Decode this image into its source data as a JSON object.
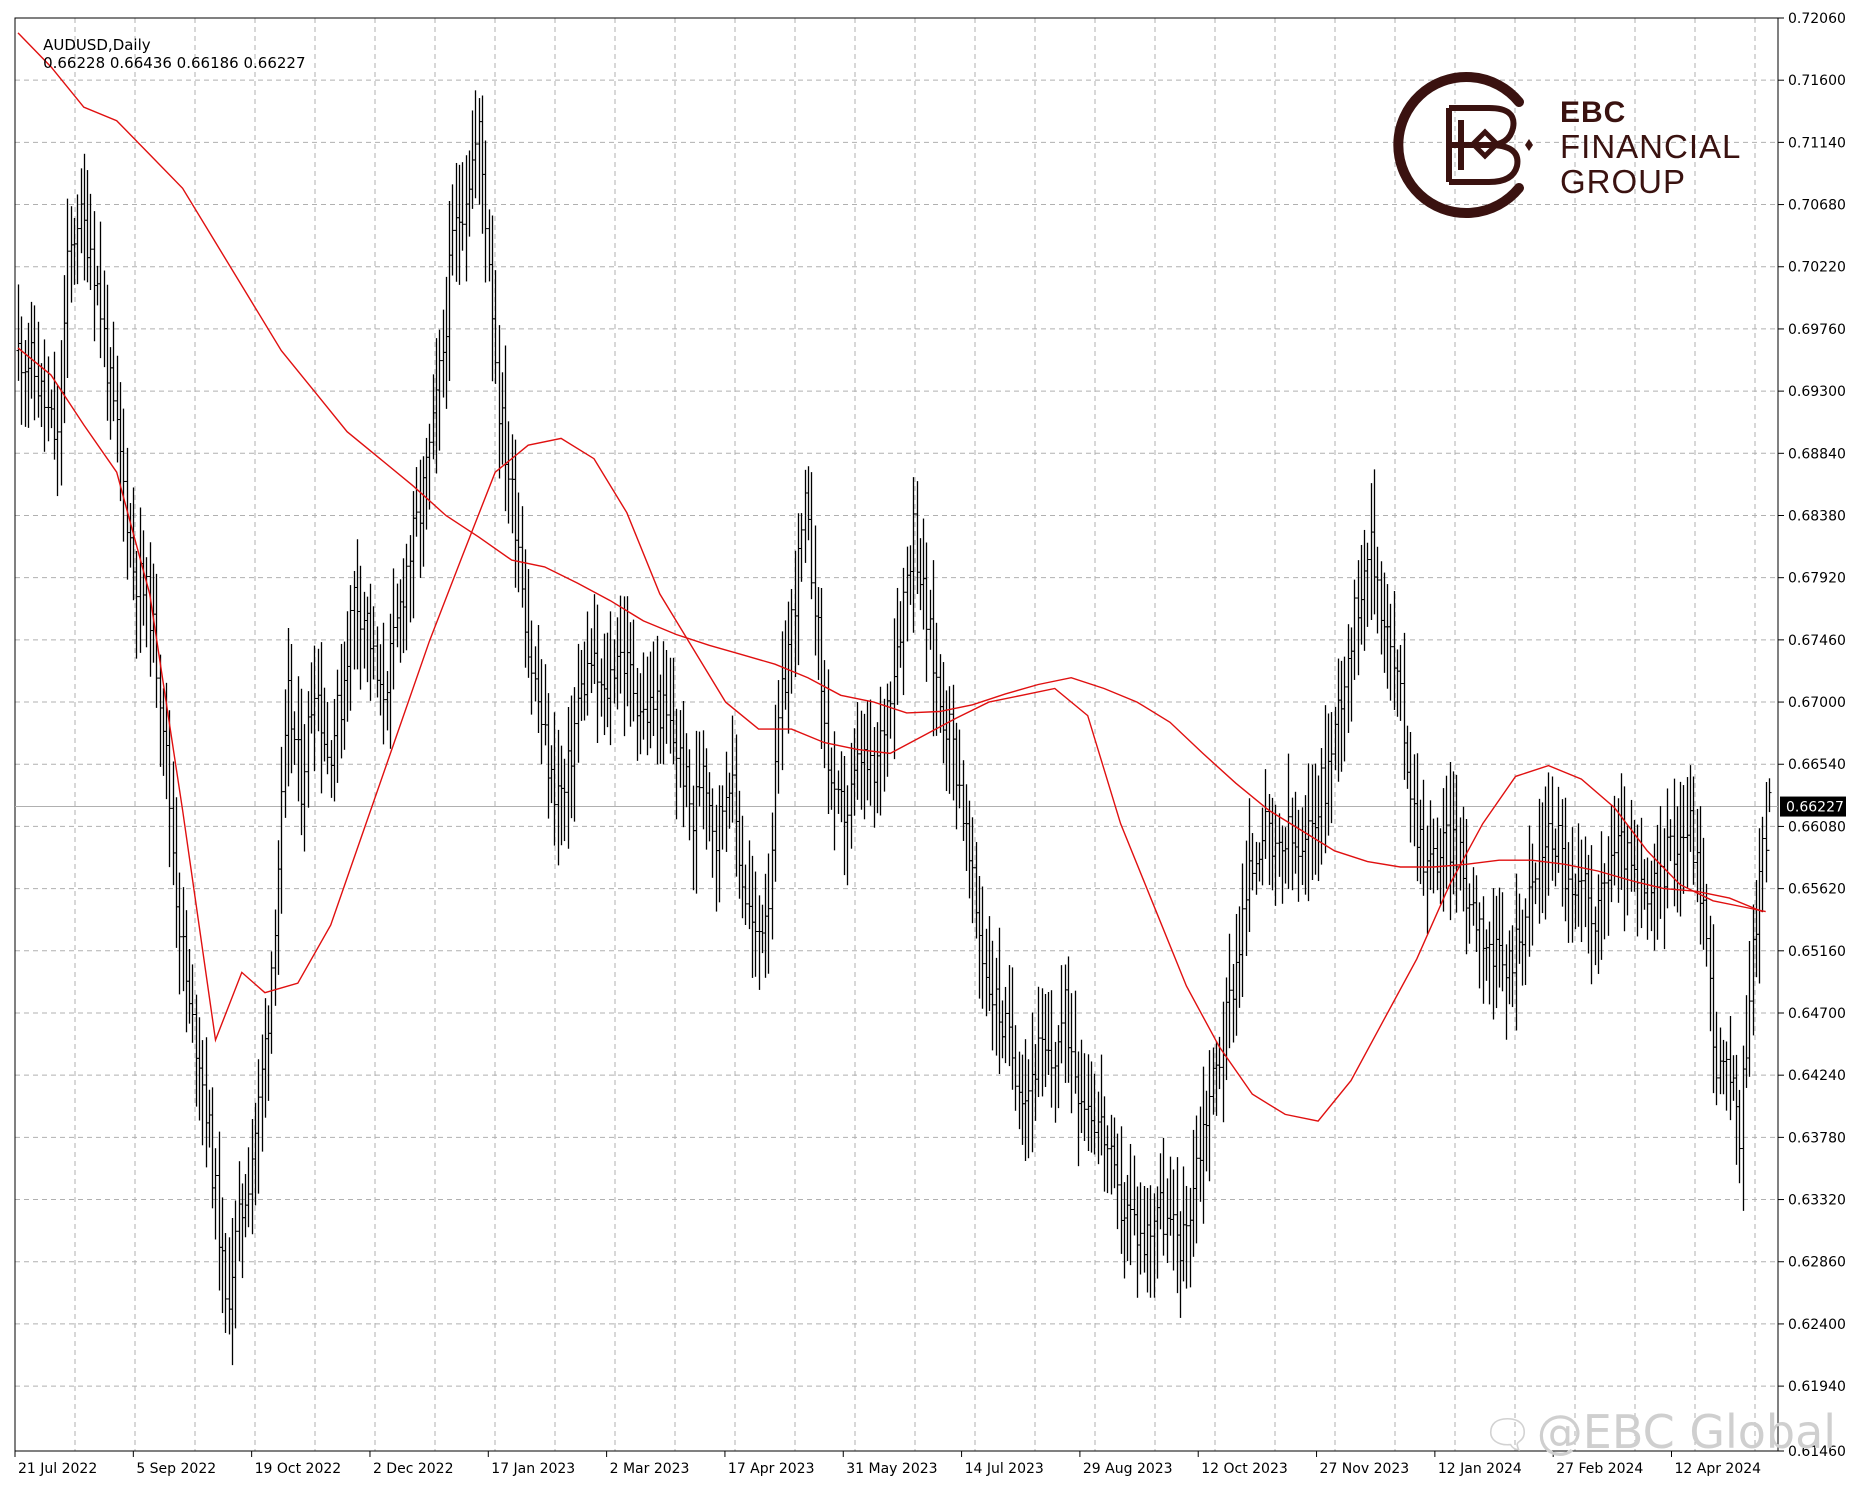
{
  "header": {
    "symbol": "AUDUSD,Daily",
    "ohlc": "0.66228 0.66436 0.66186 0.66227"
  },
  "logo": {
    "line1": "EBC",
    "line2": "FINANCIAL",
    "line3": "GROUP",
    "color": "#3a1210"
  },
  "watermark": {
    "text": "@EBC Global",
    "icon": "chat-bubble-icon"
  },
  "colors": {
    "bars": "#000000",
    "ma": "#e01010",
    "grid": "#b0b0b0",
    "price_tag_bg": "#000000",
    "price_tag_text": "#ffffff"
  },
  "chart_data": {
    "type": "ohlc_bar",
    "title": "AUDUSD,Daily",
    "symbol": "AUDUSD",
    "timeframe": "Daily",
    "last": {
      "open": 0.66228,
      "high": 0.66436,
      "low": 0.66186,
      "close": 0.66227
    },
    "current_price_label": "0.66227",
    "ylim": [
      0.6146,
      0.7206
    ],
    "grid": true,
    "y_ticks": [
      "0.72060",
      "0.71600",
      "0.71140",
      "0.70680",
      "0.70220",
      "0.69760",
      "0.69300",
      "0.68840",
      "0.68380",
      "0.67920",
      "0.67460",
      "0.67000",
      "0.66540",
      "0.66080",
      "0.65620",
      "0.65160",
      "0.64700",
      "0.64240",
      "0.63780",
      "0.63320",
      "0.62860",
      "0.62400",
      "0.61940",
      "0.61460"
    ],
    "x_ticks": [
      "21 Jul 2022",
      "5 Sep 2022",
      "19 Oct 2022",
      "2 Dec 2022",
      "17 Jan 2023",
      "2 Mar 2023",
      "17 Apr 2023",
      "31 May 2023",
      "14 Jul 2023",
      "29 Aug 2023",
      "12 Oct 2023",
      "27 Nov 2023",
      "12 Jan 2024",
      "27 Feb 2024",
      "12 Apr 2024"
    ],
    "close_path": [
      [
        0,
        0.696
      ],
      [
        8,
        0.695
      ],
      [
        16,
        0.692
      ],
      [
        24,
        0.689
      ],
      [
        30,
        0.702
      ],
      [
        36,
        0.706
      ],
      [
        44,
        0.704
      ],
      [
        50,
        0.699
      ],
      [
        56,
        0.693
      ],
      [
        62,
        0.688
      ],
      [
        70,
        0.68
      ],
      [
        80,
        0.677
      ],
      [
        88,
        0.669
      ],
      [
        96,
        0.656
      ],
      [
        104,
        0.647
      ],
      [
        110,
        0.644
      ],
      [
        116,
        0.638
      ],
      [
        122,
        0.631
      ],
      [
        126,
        0.625
      ],
      [
        132,
        0.63
      ],
      [
        140,
        0.635
      ],
      [
        146,
        0.64
      ],
      [
        152,
        0.647
      ],
      [
        158,
        0.658
      ],
      [
        164,
        0.67
      ],
      [
        172,
        0.664
      ],
      [
        180,
        0.672
      ],
      [
        188,
        0.666
      ],
      [
        196,
        0.67
      ],
      [
        204,
        0.678
      ],
      [
        212,
        0.676
      ],
      [
        220,
        0.67
      ],
      [
        228,
        0.674
      ],
      [
        236,
        0.68
      ],
      [
        244,
        0.684
      ],
      [
        252,
        0.69
      ],
      [
        258,
        0.696
      ],
      [
        264,
        0.704
      ],
      [
        272,
        0.708
      ],
      [
        280,
        0.712
      ],
      [
        286,
        0.703
      ],
      [
        292,
        0.692
      ],
      [
        298,
        0.687
      ],
      [
        304,
        0.682
      ],
      [
        310,
        0.674
      ],
      [
        316,
        0.67
      ],
      [
        324,
        0.664
      ],
      [
        332,
        0.663
      ],
      [
        340,
        0.67
      ],
      [
        348,
        0.673
      ],
      [
        356,
        0.67
      ],
      [
        364,
        0.674
      ],
      [
        372,
        0.672
      ],
      [
        380,
        0.669
      ],
      [
        388,
        0.67
      ],
      [
        396,
        0.668
      ],
      [
        404,
        0.665
      ],
      [
        410,
        0.661
      ],
      [
        416,
        0.666
      ],
      [
        424,
        0.66
      ],
      [
        432,
        0.665
      ],
      [
        440,
        0.657
      ],
      [
        448,
        0.652
      ],
      [
        456,
        0.656
      ],
      [
        462,
        0.668
      ],
      [
        470,
        0.676
      ],
      [
        478,
        0.684
      ],
      [
        484,
        0.678
      ],
      [
        490,
        0.668
      ],
      [
        496,
        0.662
      ],
      [
        504,
        0.662
      ],
      [
        512,
        0.666
      ],
      [
        520,
        0.664
      ],
      [
        528,
        0.67
      ],
      [
        536,
        0.676
      ],
      [
        544,
        0.683
      ],
      [
        552,
        0.676
      ],
      [
        560,
        0.67
      ],
      [
        566,
        0.668
      ],
      [
        572,
        0.664
      ],
      [
        580,
        0.656
      ],
      [
        588,
        0.65
      ],
      [
        596,
        0.647
      ],
      [
        604,
        0.644
      ],
      [
        612,
        0.641
      ],
      [
        620,
        0.644
      ],
      [
        628,
        0.643
      ],
      [
        636,
        0.647
      ],
      [
        644,
        0.642
      ],
      [
        652,
        0.64
      ],
      [
        660,
        0.638
      ],
      [
        668,
        0.633
      ],
      [
        676,
        0.632
      ],
      [
        684,
        0.63
      ],
      [
        692,
        0.633
      ],
      [
        700,
        0.631
      ],
      [
        708,
        0.63
      ],
      [
        716,
        0.636
      ],
      [
        724,
        0.641
      ],
      [
        732,
        0.645
      ],
      [
        740,
        0.651
      ],
      [
        748,
        0.657
      ],
      [
        756,
        0.661
      ],
      [
        764,
        0.658
      ],
      [
        772,
        0.66
      ],
      [
        780,
        0.658
      ],
      [
        788,
        0.662
      ],
      [
        796,
        0.665
      ],
      [
        804,
        0.671
      ],
      [
        812,
        0.676
      ],
      [
        820,
        0.682
      ],
      [
        826,
        0.679
      ],
      [
        832,
        0.675
      ],
      [
        840,
        0.67
      ],
      [
        848,
        0.662
      ],
      [
        856,
        0.658
      ],
      [
        864,
        0.659
      ],
      [
        872,
        0.66
      ],
      [
        880,
        0.656
      ],
      [
        888,
        0.654
      ],
      [
        896,
        0.651
      ],
      [
        904,
        0.65
      ],
      [
        912,
        0.653
      ],
      [
        920,
        0.656
      ],
      [
        928,
        0.66
      ],
      [
        936,
        0.66
      ],
      [
        944,
        0.655
      ],
      [
        952,
        0.656
      ],
      [
        960,
        0.654
      ],
      [
        968,
        0.659
      ],
      [
        976,
        0.659
      ],
      [
        984,
        0.656
      ],
      [
        992,
        0.655
      ],
      [
        1000,
        0.658
      ],
      [
        1008,
        0.66
      ],
      [
        1016,
        0.661
      ],
      [
        1024,
        0.655
      ],
      [
        1032,
        0.643
      ],
      [
        1040,
        0.642
      ],
      [
        1046,
        0.638
      ],
      [
        1052,
        0.649
      ],
      [
        1058,
        0.657
      ],
      [
        1064,
        0.6622
      ]
    ],
    "series": [
      {
        "color": "#e01010",
        "values": [
          [
            0,
            0.7195
          ],
          [
            20,
            0.717
          ],
          [
            40,
            0.714
          ],
          [
            60,
            0.713
          ],
          [
            80,
            0.7105
          ],
          [
            100,
            0.708
          ],
          [
            120,
            0.704
          ],
          [
            140,
            0.7
          ],
          [
            160,
            0.696
          ],
          [
            180,
            0.693
          ],
          [
            200,
            0.69
          ],
          [
            220,
            0.688
          ],
          [
            240,
            0.686
          ],
          [
            260,
            0.6838
          ],
          [
            280,
            0.6822
          ],
          [
            300,
            0.6805
          ],
          [
            320,
            0.68
          ],
          [
            340,
            0.6788
          ],
          [
            360,
            0.6775
          ],
          [
            380,
            0.676
          ],
          [
            400,
            0.675
          ],
          [
            420,
            0.6742
          ],
          [
            440,
            0.6735
          ],
          [
            460,
            0.6728
          ],
          [
            480,
            0.6718
          ],
          [
            500,
            0.6705
          ],
          [
            520,
            0.67
          ],
          [
            540,
            0.6692
          ],
          [
            560,
            0.6693
          ],
          [
            580,
            0.6698
          ],
          [
            600,
            0.6706
          ],
          [
            620,
            0.6713
          ],
          [
            640,
            0.6718
          ],
          [
            660,
            0.671
          ],
          [
            680,
            0.67
          ],
          [
            700,
            0.6685
          ],
          [
            720,
            0.6662
          ],
          [
            740,
            0.664
          ],
          [
            760,
            0.662
          ],
          [
            780,
            0.6605
          ],
          [
            800,
            0.659
          ],
          [
            820,
            0.6582
          ],
          [
            840,
            0.6578
          ],
          [
            860,
            0.6578
          ],
          [
            880,
            0.658
          ],
          [
            900,
            0.6583
          ],
          [
            920,
            0.6583
          ],
          [
            940,
            0.658
          ],
          [
            960,
            0.6575
          ],
          [
            980,
            0.6568
          ],
          [
            1000,
            0.6562
          ],
          [
            1020,
            0.656
          ],
          [
            1040,
            0.6555
          ],
          [
            1060,
            0.6545
          ]
        ]
      },
      {
        "color": "#e01010",
        "values": [
          [
            0,
            0.6962
          ],
          [
            20,
            0.6942
          ],
          [
            40,
            0.6905
          ],
          [
            60,
            0.687
          ],
          [
            80,
            0.678
          ],
          [
            100,
            0.662
          ],
          [
            120,
            0.645
          ],
          [
            136,
            0.65
          ],
          [
            150,
            0.6485
          ],
          [
            170,
            0.6492
          ],
          [
            190,
            0.6535
          ],
          [
            210,
            0.6605
          ],
          [
            230,
            0.6675
          ],
          [
            250,
            0.6745
          ],
          [
            270,
            0.6808
          ],
          [
            290,
            0.687
          ],
          [
            310,
            0.689
          ],
          [
            330,
            0.6895
          ],
          [
            350,
            0.688
          ],
          [
            370,
            0.684
          ],
          [
            390,
            0.678
          ],
          [
            410,
            0.674
          ],
          [
            430,
            0.67
          ],
          [
            450,
            0.668
          ],
          [
            470,
            0.668
          ],
          [
            490,
            0.667
          ],
          [
            510,
            0.6665
          ],
          [
            530,
            0.6662
          ],
          [
            550,
            0.6675
          ],
          [
            570,
            0.6688
          ],
          [
            590,
            0.67
          ],
          [
            610,
            0.6705
          ],
          [
            630,
            0.671
          ],
          [
            650,
            0.669
          ],
          [
            670,
            0.661
          ],
          [
            690,
            0.655
          ],
          [
            710,
            0.649
          ],
          [
            730,
            0.6445
          ],
          [
            750,
            0.641
          ],
          [
            770,
            0.6395
          ],
          [
            790,
            0.639
          ],
          [
            810,
            0.642
          ],
          [
            830,
            0.6465
          ],
          [
            850,
            0.651
          ],
          [
            870,
            0.6565
          ],
          [
            890,
            0.661
          ],
          [
            910,
            0.6645
          ],
          [
            930,
            0.6653
          ],
          [
            950,
            0.6643
          ],
          [
            970,
            0.6622
          ],
          [
            990,
            0.659
          ],
          [
            1010,
            0.6565
          ],
          [
            1030,
            0.6553
          ],
          [
            1050,
            0.6548
          ],
          [
            1062,
            0.6545
          ]
        ]
      }
    ]
  }
}
